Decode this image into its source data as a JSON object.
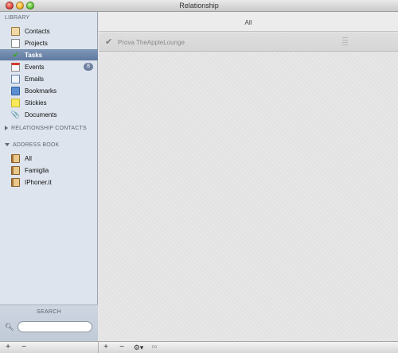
{
  "window": {
    "title": "Relationship"
  },
  "sidebar": {
    "library_header": "LIBRARY",
    "library_items": [
      {
        "label": "Contacts",
        "icon": "contacts-icon"
      },
      {
        "label": "Projects",
        "icon": "projects-icon"
      },
      {
        "label": "Tasks",
        "icon": "checkmark-icon",
        "selected": true
      },
      {
        "label": "Events",
        "icon": "calendar-icon",
        "badge": "8"
      },
      {
        "label": "Emails",
        "icon": "email-icon"
      },
      {
        "label": "Bookmarks",
        "icon": "bookmark-icon"
      },
      {
        "label": "Stickies",
        "icon": "stickies-icon"
      },
      {
        "label": "Documents",
        "icon": "paperclip-icon"
      }
    ],
    "relationship_contacts_header": "RELATIONSHIP CONTACTS",
    "address_book_header": "ADDRESS BOOK",
    "address_book_items": [
      {
        "label": "All"
      },
      {
        "label": "Famiglia"
      },
      {
        "label": "IPhoner.it"
      }
    ],
    "search": {
      "label": "SEARCH",
      "value": "",
      "placeholder": ""
    }
  },
  "main": {
    "header_title": "All",
    "tasks": [
      {
        "title": "Prova TheAppleLounge",
        "done": true
      }
    ]
  },
  "bottombar": {
    "sidebar_add": "+",
    "sidebar_remove": "−",
    "main_add": "+",
    "main_remove": "−",
    "action_menu": "⚙▾",
    "link": "∞"
  },
  "colors": {
    "selection": "#6a84a9",
    "sidebar_bg": "#dde4ed",
    "badge": "#6e80a0"
  }
}
